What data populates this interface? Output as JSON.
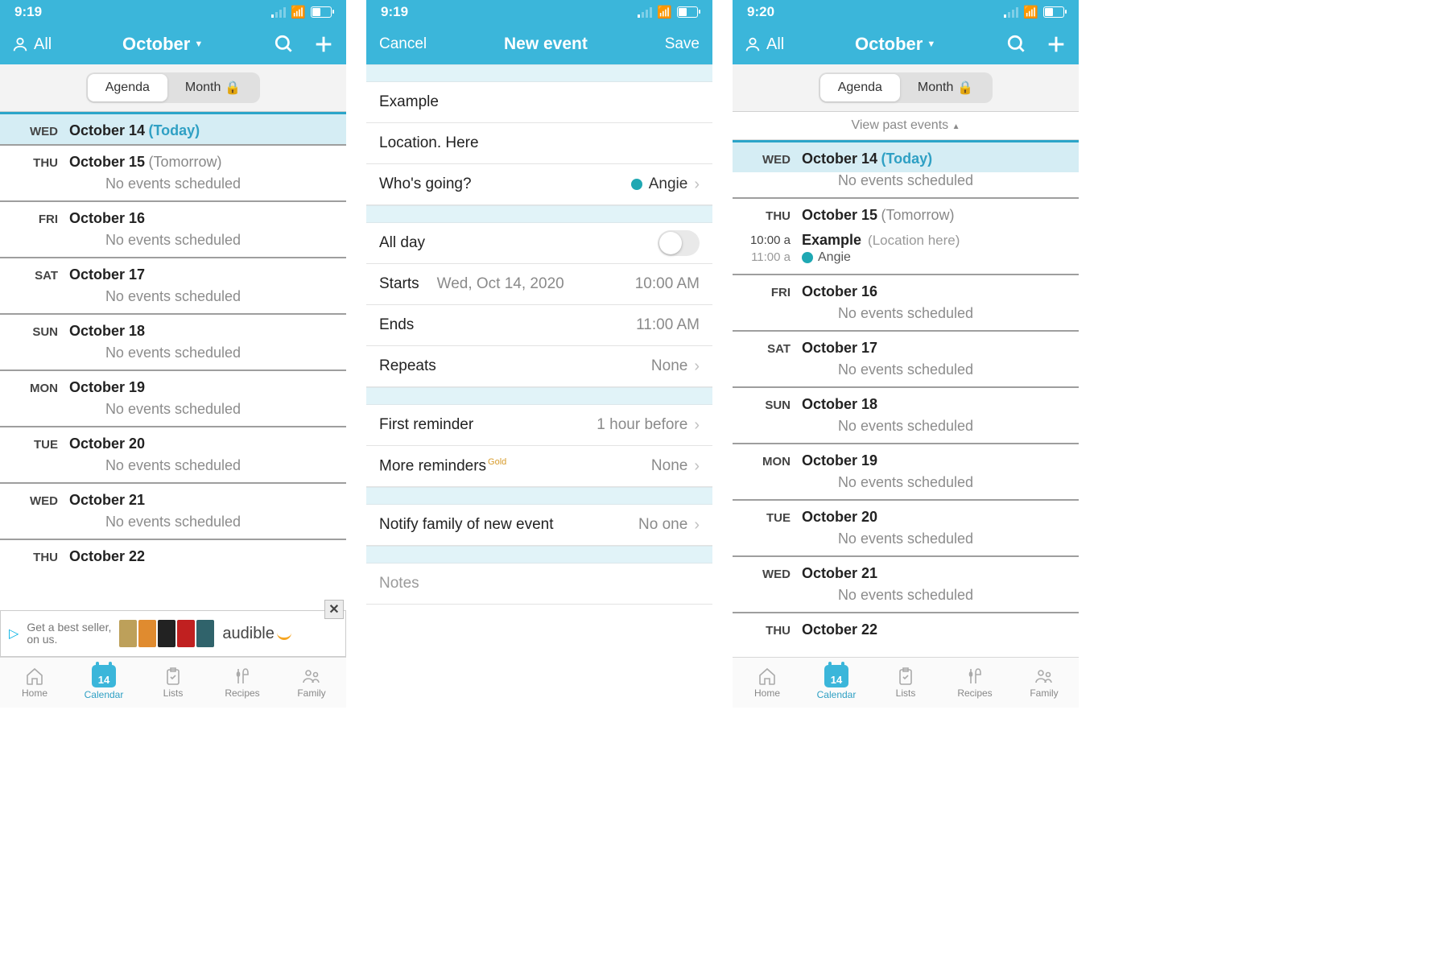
{
  "status": {
    "time1": "9:19",
    "time2": "9:19",
    "time3": "9:20"
  },
  "header": {
    "all": "All",
    "month": "October",
    "cancel": "Cancel",
    "new_event": "New event",
    "save": "Save"
  },
  "segment": {
    "agenda": "Agenda",
    "month": "Month"
  },
  "past_link": "View past events",
  "agenda1": [
    {
      "abbr": "WED",
      "date": "October 14",
      "tag": "(Today)",
      "today": true,
      "empty": ""
    },
    {
      "abbr": "THU",
      "date": "October 15",
      "tag": "(Tomorrow)",
      "empty": "No events scheduled"
    },
    {
      "abbr": "FRI",
      "date": "October 16",
      "empty": "No events scheduled"
    },
    {
      "abbr": "SAT",
      "date": "October 17",
      "empty": "No events scheduled"
    },
    {
      "abbr": "SUN",
      "date": "October 18",
      "empty": "No events scheduled"
    },
    {
      "abbr": "MON",
      "date": "October 19",
      "empty": "No events scheduled"
    },
    {
      "abbr": "TUE",
      "date": "October 20",
      "empty": "No events scheduled"
    },
    {
      "abbr": "WED",
      "date": "October 21",
      "empty": "No events scheduled"
    },
    {
      "abbr": "THU",
      "date": "October 22"
    }
  ],
  "agenda3": [
    {
      "abbr": "WED",
      "date": "October 14",
      "tag": "(Today)",
      "today": true,
      "empty": "No events scheduled"
    },
    {
      "abbr": "THU",
      "date": "October 15",
      "tag": "(Tomorrow)",
      "event": {
        "t1": "10:00 a",
        "t2": "11:00 a",
        "title": "Example",
        "loc": "(Location here)",
        "who": "Angie"
      }
    },
    {
      "abbr": "FRI",
      "date": "October 16",
      "empty": "No events scheduled"
    },
    {
      "abbr": "SAT",
      "date": "October 17",
      "empty": "No events scheduled"
    },
    {
      "abbr": "SUN",
      "date": "October 18",
      "empty": "No events scheduled"
    },
    {
      "abbr": "MON",
      "date": "October 19",
      "empty": "No events scheduled"
    },
    {
      "abbr": "TUE",
      "date": "October 20",
      "empty": "No events scheduled"
    },
    {
      "abbr": "WED",
      "date": "October 21",
      "empty": "No events scheduled"
    },
    {
      "abbr": "THU",
      "date": "October 22"
    }
  ],
  "form": {
    "title": "Example",
    "location": "Location. Here",
    "who_label": "Who's going?",
    "who_value": "Angie",
    "allday": "All day",
    "starts": "Starts",
    "starts_date": "Wed, Oct 14, 2020",
    "starts_time": "10:00 AM",
    "ends": "Ends",
    "ends_time": "11:00 AM",
    "repeats": "Repeats",
    "repeats_val": "None",
    "first_rem": "First reminder",
    "first_rem_val": "1 hour before",
    "more_rem": "More reminders",
    "more_rem_badge": "Gold",
    "more_rem_val": "None",
    "notify": "Notify family of new event",
    "notify_val": "No one",
    "notes": "Notes"
  },
  "ad": {
    "line1": "Get a best seller,",
    "line2": "on us.",
    "brand": "audible"
  },
  "tabs": {
    "home": "Home",
    "calendar": "Calendar",
    "calendar_day": "14",
    "lists": "Lists",
    "recipes": "Recipes",
    "family": "Family"
  }
}
